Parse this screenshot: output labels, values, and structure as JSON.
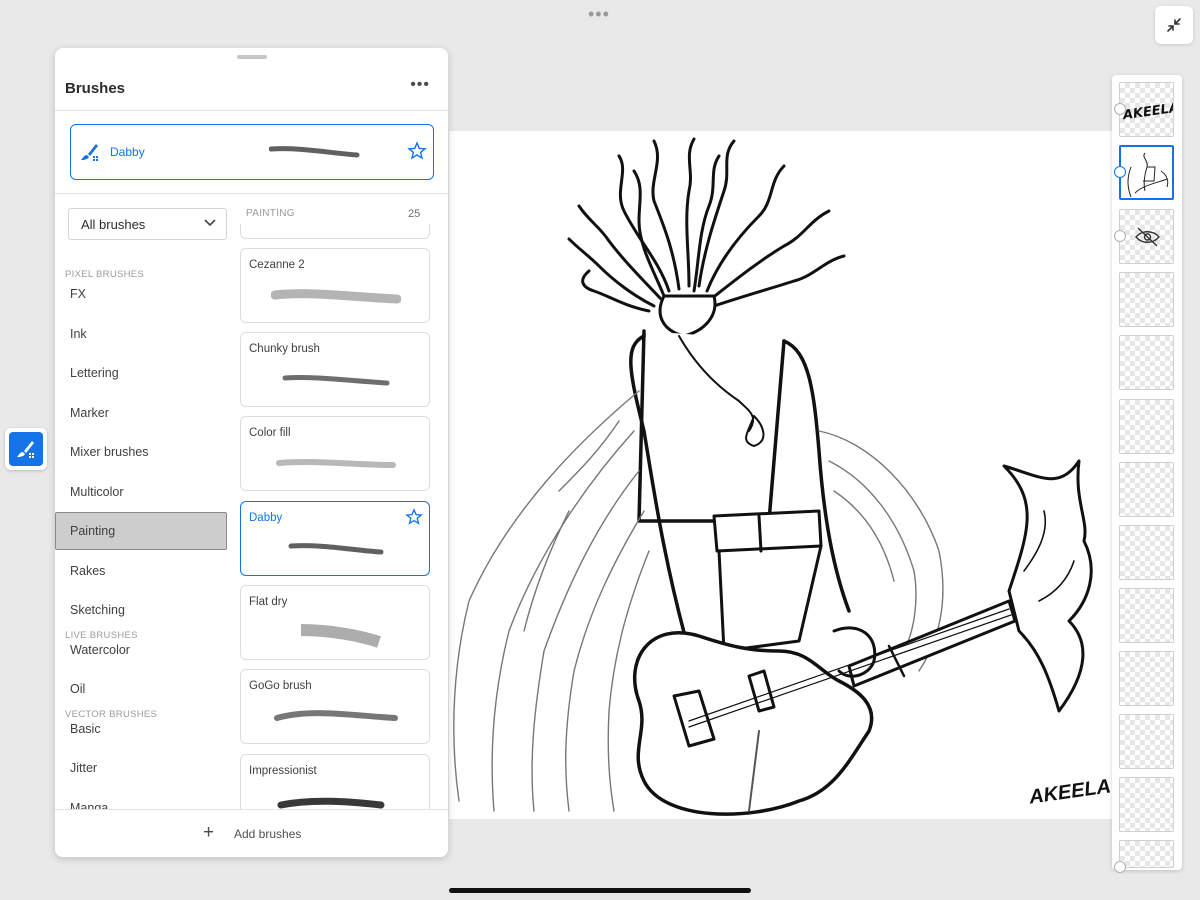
{
  "panel": {
    "title": "Brushes",
    "current_brush": {
      "name": "Dabby"
    },
    "filter": {
      "selected": "All brushes"
    },
    "sections": {
      "pixel": "PIXEL BRUSHES",
      "live": "LIVE BRUSHES",
      "vector": "VECTOR BRUSHES"
    },
    "categories": {
      "pixel": [
        "FX",
        "Ink",
        "Lettering",
        "Marker",
        "Mixer brushes",
        "Multicolor",
        "Painting",
        "Rakes",
        "Sketching"
      ],
      "live": [
        "Watercolor",
        "Oil"
      ],
      "vector": [
        "Basic",
        "Jitter",
        "Manga"
      ]
    },
    "selected_category": "Painting",
    "list_header": "PAINTING",
    "list_count": "25",
    "brushes": [
      "Cezanne 2",
      "Chunky brush",
      "Color fill",
      "Dabby",
      "Flat dry",
      "GoGo brush",
      "Impressionist"
    ],
    "selected_brush": "Dabby",
    "add_label": "Add brushes"
  },
  "layers": {
    "count": 13,
    "selected_index": 1,
    "thumb_text": "AKEELA"
  },
  "canvas": {
    "signature": "AKEELA"
  },
  "colors": {
    "accent": "#1473e6",
    "background": "#e9e9e9",
    "selected_category_bg": "#cdcdcd"
  }
}
